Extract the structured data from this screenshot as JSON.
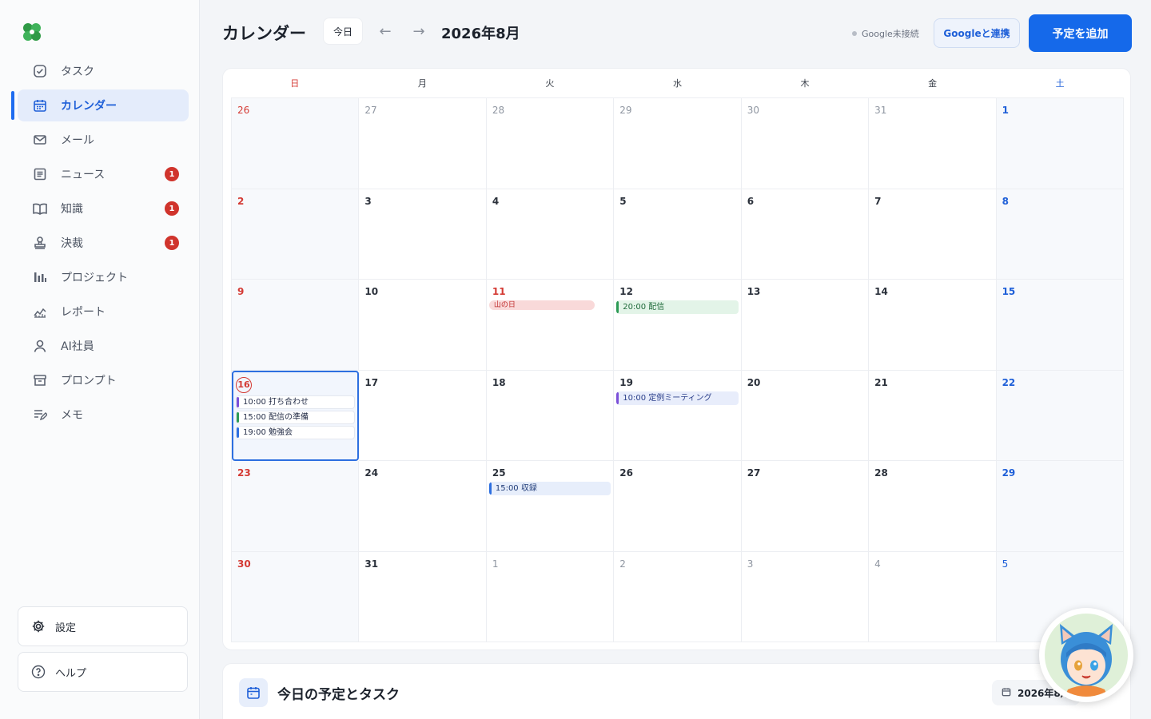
{
  "sidebar": {
    "items": [
      {
        "label": "タスク",
        "icon": "check-square-icon"
      },
      {
        "label": "カレンダー",
        "icon": "calendar-icon",
        "active": true
      },
      {
        "label": "メール",
        "icon": "mail-icon"
      },
      {
        "label": "ニュース",
        "icon": "news-icon",
        "badge": "1"
      },
      {
        "label": "知識",
        "icon": "book-icon",
        "badge": "1"
      },
      {
        "label": "決裁",
        "icon": "stamp-icon",
        "badge": "1"
      },
      {
        "label": "プロジェクト",
        "icon": "bar-chart-icon"
      },
      {
        "label": "レポート",
        "icon": "line-chart-icon"
      },
      {
        "label": "AI社員",
        "icon": "user-icon"
      },
      {
        "label": "プロンプト",
        "icon": "archive-icon"
      },
      {
        "label": "メモ",
        "icon": "edit-note-icon"
      }
    ],
    "settings_label": "設定",
    "help_label": "ヘルプ"
  },
  "header": {
    "title": "カレンダー",
    "today_label": "今日",
    "month": "2026年8月",
    "google_status": "Google未接続",
    "google_connect_label": "Googleと連携",
    "add_label": "予定を追加"
  },
  "calendar": {
    "weekdays": [
      "日",
      "月",
      "火",
      "水",
      "木",
      "金",
      "土"
    ],
    "weeks": [
      [
        {
          "d": "26",
          "o": 1
        },
        {
          "d": "27",
          "o": 1
        },
        {
          "d": "28",
          "o": 1
        },
        {
          "d": "29",
          "o": 1
        },
        {
          "d": "30",
          "o": 1
        },
        {
          "d": "31",
          "o": 1
        },
        {
          "d": "1"
        }
      ],
      [
        {
          "d": "2"
        },
        {
          "d": "3"
        },
        {
          "d": "4"
        },
        {
          "d": "5"
        },
        {
          "d": "6"
        },
        {
          "d": "7"
        },
        {
          "d": "8"
        }
      ],
      [
        {
          "d": "9"
        },
        {
          "d": "10"
        },
        {
          "d": "11",
          "holiday": 1,
          "events": [
            {
              "t": "山の日",
              "c": "holiday"
            }
          ]
        },
        {
          "d": "12",
          "events": [
            {
              "t": "20:00 配信",
              "c": "green"
            }
          ]
        },
        {
          "d": "13"
        },
        {
          "d": "14"
        },
        {
          "d": "15"
        }
      ],
      [
        {
          "d": "16",
          "today": 1,
          "events": [
            {
              "t": "10:00 打ち合わせ",
              "c": "white p"
            },
            {
              "t": "15:00 配信の準備",
              "c": "white g"
            },
            {
              "t": "19:00 勉強会",
              "c": "white"
            }
          ]
        },
        {
          "d": "17"
        },
        {
          "d": "18"
        },
        {
          "d": "19",
          "events": [
            {
              "t": "10:00 定例ミーティング",
              "c": "purple"
            }
          ]
        },
        {
          "d": "20"
        },
        {
          "d": "21"
        },
        {
          "d": "22"
        }
      ],
      [
        {
          "d": "23"
        },
        {
          "d": "24"
        },
        {
          "d": "25",
          "events": [
            {
              "t": "15:00 収録",
              "c": "blue"
            }
          ]
        },
        {
          "d": "26"
        },
        {
          "d": "27"
        },
        {
          "d": "28"
        },
        {
          "d": "29"
        }
      ],
      [
        {
          "d": "30"
        },
        {
          "d": "31"
        },
        {
          "d": "1",
          "o": 1
        },
        {
          "d": "2",
          "o": 1
        },
        {
          "d": "3",
          "o": 1
        },
        {
          "d": "4",
          "o": 1
        },
        {
          "d": "5",
          "o": 1
        }
      ]
    ]
  },
  "today_panel": {
    "title": "今日の予定とタスク",
    "date": "2026年8月"
  },
  "colors": {
    "accent": "#1569ea",
    "sunday": "#d43a34",
    "saturday": "#1e5fd8",
    "badge": "#d0342c"
  }
}
